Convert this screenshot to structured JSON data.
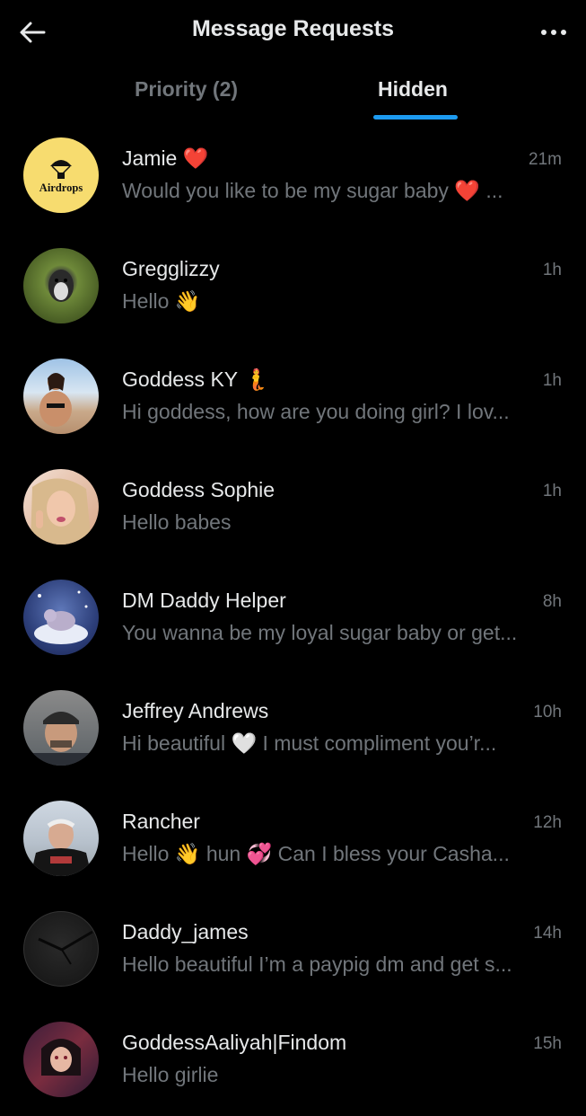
{
  "header": {
    "title": "Message Requests"
  },
  "tabs": [
    {
      "label": "Priority (2)",
      "selected": false
    },
    {
      "label": "Hidden",
      "selected": true
    }
  ],
  "colors": {
    "accent": "#1d9bf0",
    "muted": "#71767b",
    "text": "#e7e9ea",
    "background": "#000000"
  },
  "messages": [
    {
      "name": "Jamie ❤️",
      "time": "21m",
      "preview": "Would you like to be my sugar baby ❤️ ...",
      "avatar_text": "Airdrops",
      "avatar_icon": "parachute-box-icon"
    },
    {
      "name": "Gregglizzy",
      "time": "1h",
      "preview": "Hello 👋",
      "avatar_icon": "dog-photo"
    },
    {
      "name": "Goddess KY 🧜",
      "time": "1h",
      "preview": "Hi goddess, how are you doing girl? I lov...",
      "avatar_icon": "beach-photo"
    },
    {
      "name": "Goddess Sophie",
      "time": "1h",
      "preview": "Hello babes",
      "avatar_icon": "selfie-photo"
    },
    {
      "name": "DM Daddy Helper",
      "time": "8h",
      "preview": "You wanna be my loyal sugar baby or get...",
      "avatar_icon": "cat-cloud-photo"
    },
    {
      "name": "Jeffrey Andrews",
      "time": "10h",
      "preview": "Hi beautiful 🤍 I must compliment you’r...",
      "avatar_icon": "man-cap-photo"
    },
    {
      "name": "Rancher",
      "time": "12h",
      "preview": "Hello 👋 hun 💞 Can I bless your Casha...",
      "avatar_icon": "older-man-photo"
    },
    {
      "name": "Daddy_james",
      "time": "14h",
      "preview": "Hello beautiful I’m a paypig dm and get s...",
      "avatar_icon": "watch-photo"
    },
    {
      "name": "GoddessAaliyah|Findom",
      "time": "15h",
      "preview": "Hello girlie",
      "avatar_icon": "anime-photo"
    }
  ]
}
